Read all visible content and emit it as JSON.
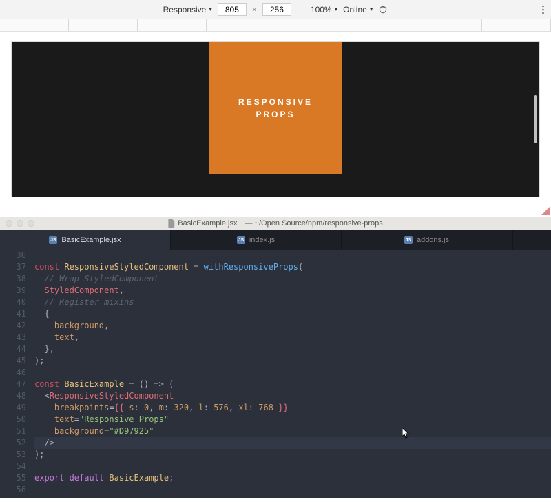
{
  "devtools": {
    "device_mode": "Responsive",
    "width": "805",
    "height": "256",
    "zoom": "100%",
    "network": "Online"
  },
  "preview": {
    "line1": "RESPONSIVE",
    "line2": "PROPS",
    "bg_color": "#D97925"
  },
  "editor": {
    "title_file": "BasicExample.jsx",
    "title_path": "— ~/Open Source/npm/responsive-props",
    "tabs": [
      {
        "label": "BasicExample.jsx",
        "active": true
      },
      {
        "label": "index.js",
        "active": false
      },
      {
        "label": "addons.js",
        "active": false
      }
    ],
    "lines": {
      "start": 36,
      "end": 56
    },
    "code": {
      "l37_const": "const",
      "l37_name": "ResponsiveStyledComponent",
      "l37_eq": " = ",
      "l37_fn": "withResponsiveProps",
      "l37_open": "(",
      "l38_cm": "// Wrap StyledComponent",
      "l39_id": "StyledComponent",
      "l39_comma": ",",
      "l40_cm": "// Register mixins",
      "l41_brace": "{",
      "l42_id": "background",
      "l42_comma": ",",
      "l43_id": "text",
      "l43_comma": ",",
      "l44_brace": "},",
      "l45_close": ");",
      "l47_const": "const",
      "l47_name": "BasicExample",
      "l47_rest": " = () => (",
      "l48_tag": "ResponsiveStyledComponent",
      "l49_attr": "breakpoints",
      "l49_eq": "=",
      "l49_open": "{{ ",
      "l49_s": "s",
      "l49_sv": "0",
      "l49_m": "m",
      "l49_mv": "320",
      "l49_l": "l",
      "l49_lv": "576",
      "l49_xl": "xl",
      "l49_xlv": "768",
      "l49_close": " }}",
      "l50_attr": "text",
      "l50_val": "\"Responsive Props\"",
      "l51_attr": "background",
      "l51_val": "\"#D97925\"",
      "l52_close": "/>",
      "l53_close": ");",
      "l55_export": "export default",
      "l55_name": "BasicExample",
      "l55_semi": ";"
    }
  }
}
